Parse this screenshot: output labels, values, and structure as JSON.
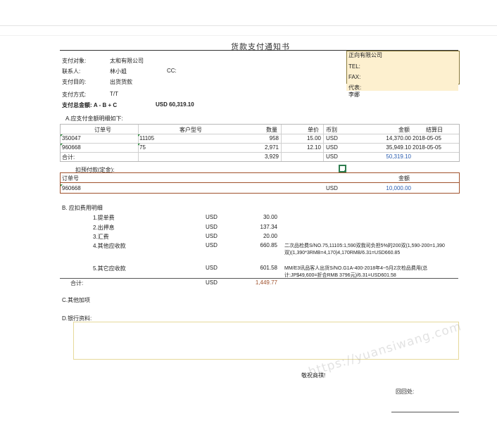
{
  "title": "货款支付通知书",
  "header": {
    "pay_to_label": "支付对象:",
    "pay_to_value": "太和有限公司",
    "contact_label": "联系人:",
    "contact_value": "林小姐",
    "cc_label": "CC:",
    "purpose_label": "支付目的:",
    "purpose_value": "出货货款",
    "method_label": "支付方式:",
    "method_value": "T/T",
    "total_label": "支付总金额: A - B + C",
    "total_value": "USD  60,319.10"
  },
  "company": {
    "name": "正向有限公司",
    "tel": "TEL:",
    "fax": "FAX:",
    "rep": "代表:",
    "rep_name": "李娜"
  },
  "section_a": {
    "title": "A.应支付金额明细如下:",
    "headers": [
      "订单号",
      "客户型号",
      "数量",
      "单价",
      "币别",
      "金额",
      "结算日"
    ],
    "rows": [
      [
        "350047",
        "11105",
        "958",
        "15.00",
        "USD",
        "14,370.00",
        "2018-05-05"
      ],
      [
        "960668",
        "75",
        "2,971",
        "12.10",
        "USD",
        "35,949.10",
        "2018-05-05"
      ]
    ],
    "sum_label": "合计:",
    "sum_qty": "3,929",
    "sum_currency": "USD",
    "sum_amount": "50,319.10"
  },
  "prepay": {
    "title": "扣预付款(定金):",
    "header_order": "订单号",
    "header_amount": "金额",
    "order": "960668",
    "currency": "USD",
    "amount": "10,000.00"
  },
  "section_b": {
    "title": "B. 应扣费用明细",
    "items": [
      {
        "label": "1.提单费",
        "currency": "USD",
        "amount": "30.00",
        "note": ""
      },
      {
        "label": "2.出押息",
        "currency": "USD",
        "amount": "137.34",
        "note": ""
      },
      {
        "label": "3.汇费",
        "currency": "USD",
        "amount": "20.00",
        "note": ""
      },
      {
        "label": "4.其他应收款",
        "currency": "USD",
        "amount": "660.85",
        "note": "二次品检费S/NO.75,11105:1,590双我司负担5%的200双(1,590-200=1,390",
        "note2": "双)(1,390*3RMB=4,170)4,170RMB/6.31=USD660.85"
      },
      {
        "label": "5.其它应收款",
        "currency": "USD",
        "amount": "601.58",
        "note": "MM/E3讯品客人出货S/NO.G1A-400-2018年4~5月2次检品费用(总",
        "note2": "计:JP$49,600=折合RMB 3796元)/6.31=USD601.58"
      }
    ],
    "sum_label": "合计:",
    "sum_currency": "USD",
    "sum_amount": "1,449.77"
  },
  "section_c": {
    "title": "C.其他加项"
  },
  "section_d": {
    "title": "D.银行资料:"
  },
  "footer": {
    "thanks": "敬祝商祺!",
    "reply": "回回处:"
  },
  "watermark": "https://yuansiwang.com",
  "colors": {
    "accent_blue": "#2a5db0",
    "brown": "#a0522d",
    "company_fill": "#fdf0cf",
    "bank_border": "#e6d99a"
  }
}
